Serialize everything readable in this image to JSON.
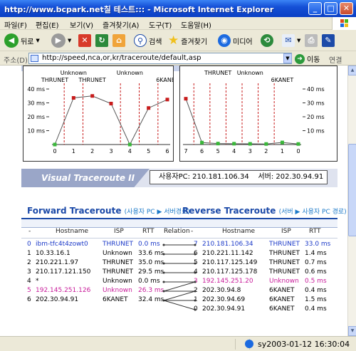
{
  "window": {
    "title": "http://www.bcpark.net칠 테스트::: - Microsoft Internet Explorer",
    "min": "_",
    "max": "□",
    "close": "✕"
  },
  "menu": [
    "파일(F)",
    "편집(E)",
    "보기(V)",
    "즐겨찾기(A)",
    "도구(T)",
    "도움말(H)"
  ],
  "toolbar": {
    "back": "뒤로",
    "search": "검색",
    "favorites": "즐겨찾기",
    "media": "미디어"
  },
  "address": {
    "label": "주소(D)",
    "url": "http://speed,nca,or,kr/traceroute/default,asp",
    "go": "이동",
    "links": "연결"
  },
  "colors": {
    "accent": "#1c4aa8",
    "highlight": "#c81c9a",
    "series": "#c81c1c",
    "guide": "#c81c1c"
  },
  "chart_data": [
    {
      "type": "line",
      "x": [
        0,
        1,
        2,
        3,
        4,
        5,
        6
      ],
      "values": [
        0,
        33.6,
        35.0,
        29.5,
        0,
        26.3,
        32.4
      ],
      "hop_labels": [
        {
          "x": 0,
          "label": "THRUNET"
        },
        {
          "x": 1,
          "label": "Unknown"
        },
        {
          "x": 2,
          "label": "THRUNET"
        },
        {
          "x": 4,
          "label": "Unknown"
        },
        {
          "x": 6,
          "label": "6KANET"
        }
      ],
      "ylim": [
        0,
        40
      ],
      "yticks": [
        "40 ms",
        "30 ms",
        "20 ms",
        "10 ms"
      ],
      "xticks": [
        "0",
        "1",
        "2",
        "3",
        "4",
        "5",
        "6"
      ]
    },
    {
      "type": "line",
      "x": [
        7,
        6,
        5,
        4,
        3,
        2,
        1,
        0
      ],
      "values": [
        33.0,
        1.4,
        0.7,
        0.6,
        0.5,
        0.4,
        1.5,
        0.4
      ],
      "hop_labels": [
        {
          "x": 5,
          "label": "THRUNET"
        },
        {
          "x": 3,
          "label": "Unknown"
        },
        {
          "x": 1,
          "label": "6KANET"
        }
      ],
      "ylim": [
        0,
        40
      ],
      "yticks": [
        "40 ms",
        "30 ms",
        "20 ms",
        "10 ms"
      ],
      "xticks": [
        "7",
        "6",
        "5",
        "4",
        "3",
        "2",
        "1",
        "0"
      ]
    }
  ],
  "banner": {
    "tab": "Visual Traceroute II",
    "user_ip_label": "사용자PC:",
    "user_ip": "210.181.106.34",
    "server_label": "서버:",
    "server_ip": "202.30.94.91"
  },
  "forward": {
    "title": "Forward Traceroute",
    "subtitle": "(사용자 PC ▶ 서버경로)",
    "headers": [
      "-",
      "Hostname",
      "ISP",
      "RTT",
      "Relation"
    ],
    "rows": [
      {
        "n": "0",
        "host": "ibm-tfc4t4zowt0",
        "isp": "THRUNET",
        "rtt": "0.0 ms",
        "style": "blue"
      },
      {
        "n": "1",
        "host": "10.33.16.1",
        "isp": "Unknown",
        "rtt": "33.6 ms",
        "style": "normal"
      },
      {
        "n": "2",
        "host": "210.221.1.97",
        "isp": "THRUNET",
        "rtt": "35.0 ms",
        "style": "normal"
      },
      {
        "n": "3",
        "host": "210.117.121.150",
        "isp": "THRUNET",
        "rtt": "29.5 ms",
        "style": "normal"
      },
      {
        "n": "4",
        "host": "*",
        "isp": "Unknown",
        "rtt": "0.0 ms",
        "style": "normal"
      },
      {
        "n": "5",
        "host": "192.145.251.126",
        "isp": "Unknown",
        "rtt": "26.3 ms",
        "style": "pink"
      },
      {
        "n": "6",
        "host": "202.30.94.91",
        "isp": "6KANET",
        "rtt": "32.4 ms",
        "style": "normal"
      }
    ]
  },
  "reverse": {
    "title": "Reverse Traceroute",
    "subtitle": "(서버 ▶ 사용자 PC 경로)",
    "headers": [
      "-",
      "Hostname",
      "ISP",
      "RTT"
    ],
    "rows": [
      {
        "n": "7",
        "host": "210.181.106.34",
        "isp": "THRUNET",
        "rtt": "33.0 ms",
        "style": "blue"
      },
      {
        "n": "6",
        "host": "210.221.11.142",
        "isp": "THRUNET",
        "rtt": "1.4 ms",
        "style": "normal"
      },
      {
        "n": "5",
        "host": "210.117.125.149",
        "isp": "THRUNET",
        "rtt": "0.7 ms",
        "style": "normal"
      },
      {
        "n": "4",
        "host": "210.117.125.178",
        "isp": "THRUNET",
        "rtt": "0.6 ms",
        "style": "normal"
      },
      {
        "n": "3",
        "host": "192.145.251.20",
        "isp": "Unknown",
        "rtt": "0.5 ms",
        "style": "pink"
      },
      {
        "n": "2",
        "host": "202.30.94.8",
        "isp": "6KANET",
        "rtt": "0.4 ms",
        "style": "normal"
      },
      {
        "n": "1",
        "host": "202.30.94.69",
        "isp": "6KANET",
        "rtt": "1.5 ms",
        "style": "normal"
      },
      {
        "n": "0",
        "host": "202.30.94.91",
        "isp": "6KANET",
        "rtt": "0.4 ms",
        "style": "normal"
      }
    ]
  },
  "status": {
    "text": "sy2003-01-12 16:30:04"
  }
}
